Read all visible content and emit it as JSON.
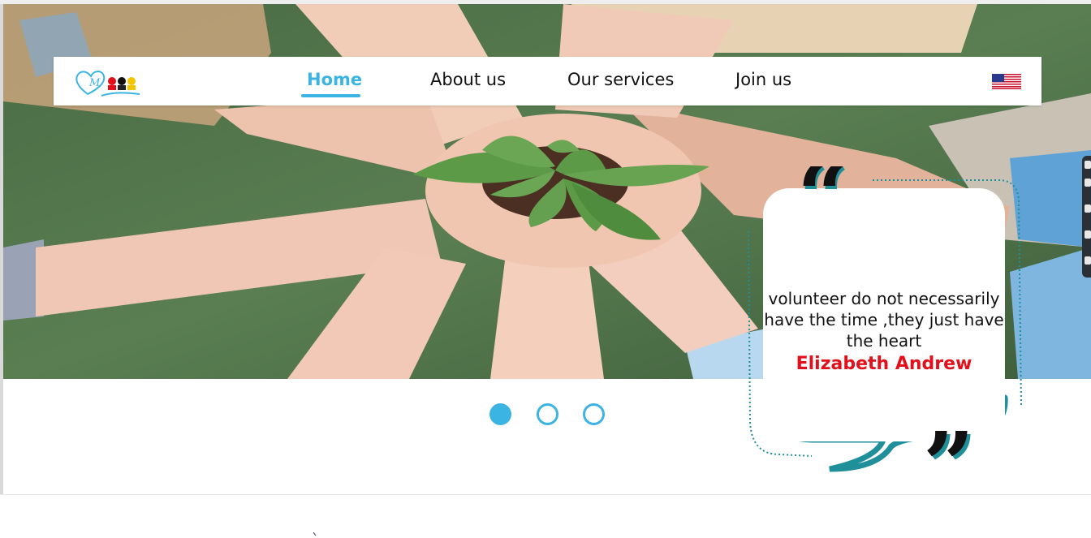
{
  "nav": {
    "logo_alt": "volunteer logo",
    "links": [
      {
        "label": "Home",
        "active": true
      },
      {
        "label": "About us",
        "active": false
      },
      {
        "label": "Our services",
        "active": false
      },
      {
        "label": "Join us",
        "active": false
      }
    ],
    "language_icon": "us-flag-icon"
  },
  "quote": {
    "text": "volunteer do not necessarily have the time ,they just have the heart",
    "author": "Elizabeth Andrew",
    "open_icon": "open-quote-icon",
    "close_icon": "close-quote-icon"
  },
  "carousel": {
    "active_index": 1,
    "total": 3
  },
  "colors": {
    "accent": "#3bb4e3",
    "author": "#e3101b",
    "teal": "#1f8f99"
  }
}
